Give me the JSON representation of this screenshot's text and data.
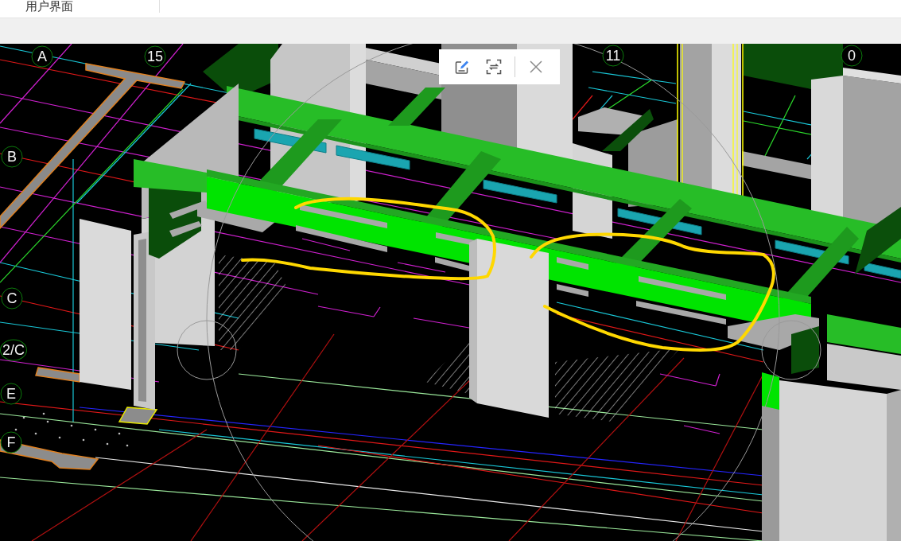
{
  "tabs": [
    {
      "label": "用户界面"
    }
  ],
  "viewport": {
    "grid_axes": [
      "A",
      "15",
      "11",
      "0",
      "B",
      "C",
      "2/C",
      "E",
      "F"
    ]
  },
  "floating_toolbar": {
    "buttons": [
      {
        "kind": "edit"
      },
      {
        "kind": "scan"
      },
      {
        "kind": "separator"
      },
      {
        "kind": "close"
      }
    ]
  }
}
